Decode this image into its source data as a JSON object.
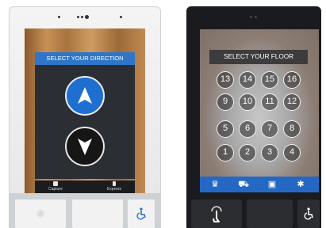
{
  "left_panel": {
    "title": "SELECT YOUR DIRECTION",
    "up_icon": "arrow-up-icon",
    "down_icon": "arrow-down-icon",
    "bottom_items": [
      {
        "label": "Capture",
        "icon": "capture-icon"
      },
      {
        "label": "Express",
        "icon": "express-icon"
      }
    ],
    "accessibility_icon": "wheelchair-icon"
  },
  "right_panel": {
    "title": "SELECT YOUR FLOOR",
    "floors": [
      [
        "13",
        "14",
        "15",
        "16"
      ],
      [
        "9",
        "10",
        "11",
        "12"
      ],
      [
        "5",
        "6",
        "7",
        "8"
      ],
      [
        "1",
        "2",
        "3",
        "4"
      ]
    ],
    "bar_icons": [
      "crown-icon",
      "cart-icon",
      "book-icon",
      "gear-icon"
    ],
    "buttons": [
      "touch-icon",
      "blank",
      "wheelchair-icon"
    ]
  },
  "colors": {
    "accent_blue": "#1f6fd1",
    "bar_blue": "#2568c4"
  }
}
